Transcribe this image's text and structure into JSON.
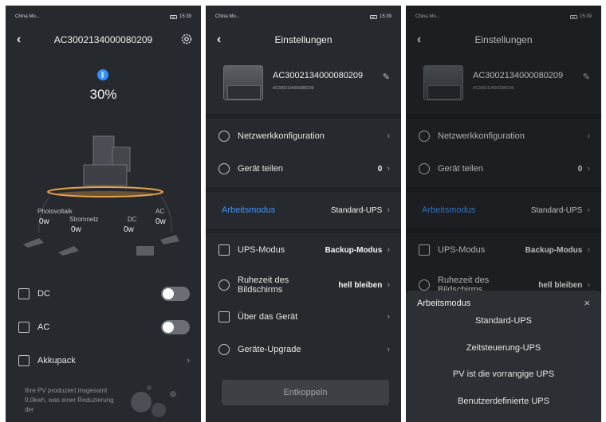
{
  "status": {
    "carrier_short": "China Mo...",
    "time": "15:39"
  },
  "p1": {
    "title": "AC3002134000080209",
    "battery_percent": "30%",
    "labels": {
      "pv": "Photovoltaik",
      "grid": "Stromnetz",
      "dc": "DC",
      "ac": "AC"
    },
    "values": {
      "pv": "0w",
      "grid": "0w",
      "dc": "0w",
      "ac": "0w"
    },
    "rows": {
      "dc": "DC",
      "ac": "AC",
      "akku": "Akkupack"
    },
    "toggles": {
      "dc": false,
      "ac": false
    },
    "tip": "Ihre PV produziert insgesamt 0,0kwh, was einer Reduzierung der"
  },
  "p2": {
    "title": "Einstellungen",
    "device_name": "AC3002134000080209",
    "device_sub": "AC3002134000080209",
    "rows": {
      "net": "Netzwerkkonfiguration",
      "share": "Gerät teilen",
      "share_val": "0",
      "mode": "Arbeitsmodus",
      "mode_val": "Standard-UPS",
      "ups": "UPS-Modus",
      "ups_val": "Backup-Modus",
      "sleep": "Ruhezeit des Bildschirms",
      "sleep_val": "hell bleiben",
      "about": "Über das Gerät",
      "upgrade": "Geräte-Upgrade"
    },
    "button": "Entkoppeln"
  },
  "p3": {
    "title": "Einstellungen",
    "device_name": "AC3002134000080209",
    "device_sub": "AC3002134000080209",
    "rows": {
      "net": "Netzwerkkonfiguration",
      "share": "Gerät teilen",
      "share_val": "0",
      "mode": "Arbeitsmodus",
      "mode_val": "Standard-UPS",
      "ups": "UPS-Modus",
      "ups_val": "Backup-Modus",
      "sleep": "Ruhezeit des Bildschirms",
      "sleep_val": "hell bleiben"
    },
    "sheet": {
      "title": "Arbeitsmodus",
      "close": "×",
      "options": [
        "Standard-UPS",
        "Zeitsteuerung-UPS",
        "PV ist die vorrangige UPS",
        "Benutzerdefinierte UPS"
      ]
    }
  },
  "colors": {
    "bg": "#26292d",
    "accent": "#3f95ff",
    "bluetooth": "#2e8fff",
    "glow": "#e8a24a"
  }
}
